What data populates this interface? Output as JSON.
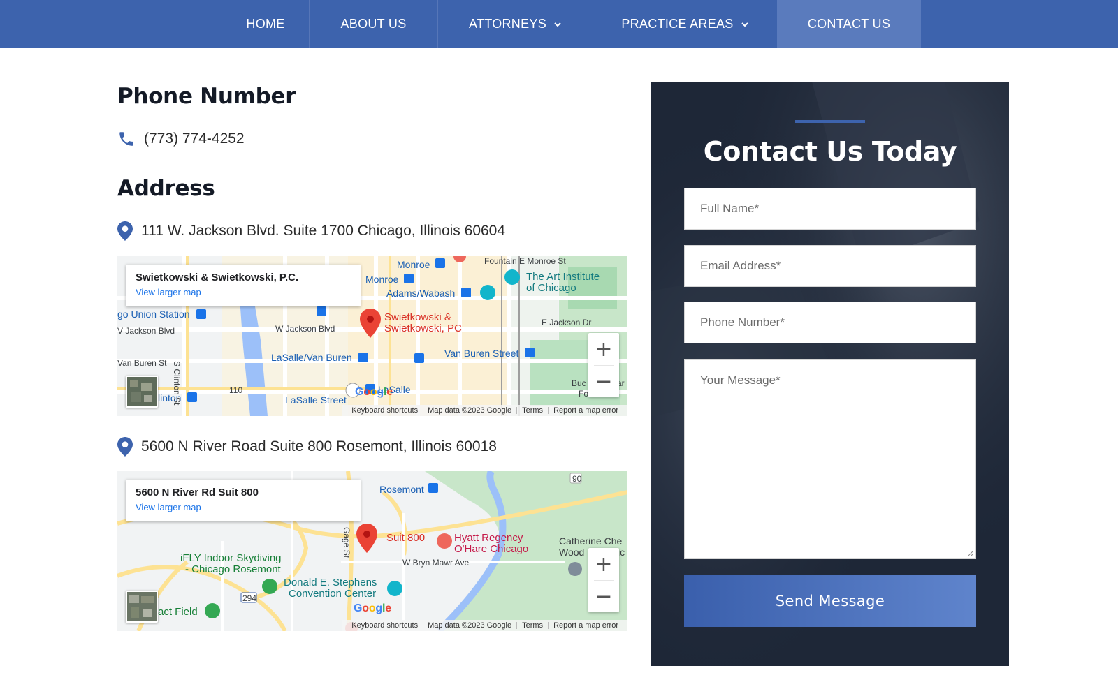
{
  "nav": {
    "items": [
      {
        "label": "HOME",
        "has_dropdown": false,
        "active": false
      },
      {
        "label": "ABOUT US",
        "has_dropdown": false,
        "active": false
      },
      {
        "label": "ATTORNEYS",
        "has_dropdown": true,
        "active": false
      },
      {
        "label": "PRACTICE AREAS",
        "has_dropdown": true,
        "active": false
      },
      {
        "label": "CONTACT US",
        "has_dropdown": false,
        "active": true
      }
    ]
  },
  "phone": {
    "heading": "Phone Number",
    "number": "(773) 774-4252"
  },
  "address": {
    "heading": "Address",
    "locations": [
      {
        "text": "111 W. Jackson Blvd. Suite 1700 Chicago, Illinois 60604",
        "map": {
          "card_title": "Swietkowski & Swietkowski, P.C.",
          "card_link": "View larger map",
          "pin_label_line1": "Swietkowski &",
          "pin_label_line2": "Swietkowski, PC",
          "labels": {
            "monroe_st": "Fountain  E Monroe St",
            "monroe1": "Monroe",
            "monroe2": "Monroe",
            "adams": "Adams/Wabash",
            "art1": "The Art Institute",
            "art2": "of Chicago",
            "union": "go Union Station",
            "jackson_w": "V Jackson Blvd",
            "clinton": "S Clinton St",
            "jackson_mid": "W Jackson Blvd",
            "jackson_e": "E Jackson Dr",
            "lasalle_vb": "LaSalle/Van Buren",
            "vanburen_st": "Van Buren Street",
            "vanburen_w": "Van Buren St",
            "hwy": "110",
            "clinton_stop": "linton",
            "lasalle_street": "LaSalle Street",
            "lasalle": "LaSalle",
            "buck1": "Buc",
            "buck2": "ar",
            "fountain": "Fountain"
          }
        },
        "attribution": [
          "Keyboard shortcuts",
          "Map data ©2023 Google",
          "Terms",
          "Report a map error"
        ]
      },
      {
        "text": "5600 N River Road Suite 800 Rosemont, Illinois 60018",
        "map": {
          "card_title": "5600 N River Rd Suit 800",
          "card_link": "View larger map",
          "pin_label_line1": "Suit 800",
          "labels": {
            "rosemont": "Rosemont",
            "hwy90": "90",
            "gage": "Gage St",
            "hyatt1": "Hyatt Regency",
            "hyatt2": "O'Hare Chicago",
            "catherine1": "Catherine Che",
            "catherine2": "Wood",
            "catherine3": "ic",
            "ifly1": "iFLY Indoor Skydiving",
            "ifly2": "- Chicago Rosemont",
            "bryn": "W Bryn Mawr Ave",
            "donald1": "Donald E. Stephens",
            "donald2": "Convention Center",
            "hwy294": "294",
            "actfield": "act Field"
          }
        },
        "attribution": [
          "Keyboard shortcuts",
          "Map data ©2023 Google",
          "Terms",
          "Report a map error"
        ]
      }
    ]
  },
  "google_logo": "Google",
  "zoom": {
    "in": "+",
    "out": "−"
  },
  "contact_form": {
    "title": "Contact Us Today",
    "full_name_placeholder": "Full Name*",
    "email_placeholder": "Email Address*",
    "phone_placeholder": "Phone Number*",
    "message_placeholder": "Your Message*",
    "submit_label": "Send Message"
  },
  "colors": {
    "nav_bg": "#3d63ad",
    "nav_active": "#5a7bbd",
    "accent_icon": "#3d63ad",
    "panel_bg": "#1e2737",
    "map_pin": "#ea4335",
    "map_link": "#1a73e8"
  },
  "icons": {
    "phone": "phone-icon",
    "location": "location-pin-icon",
    "chevron": "chevron-down-icon"
  }
}
